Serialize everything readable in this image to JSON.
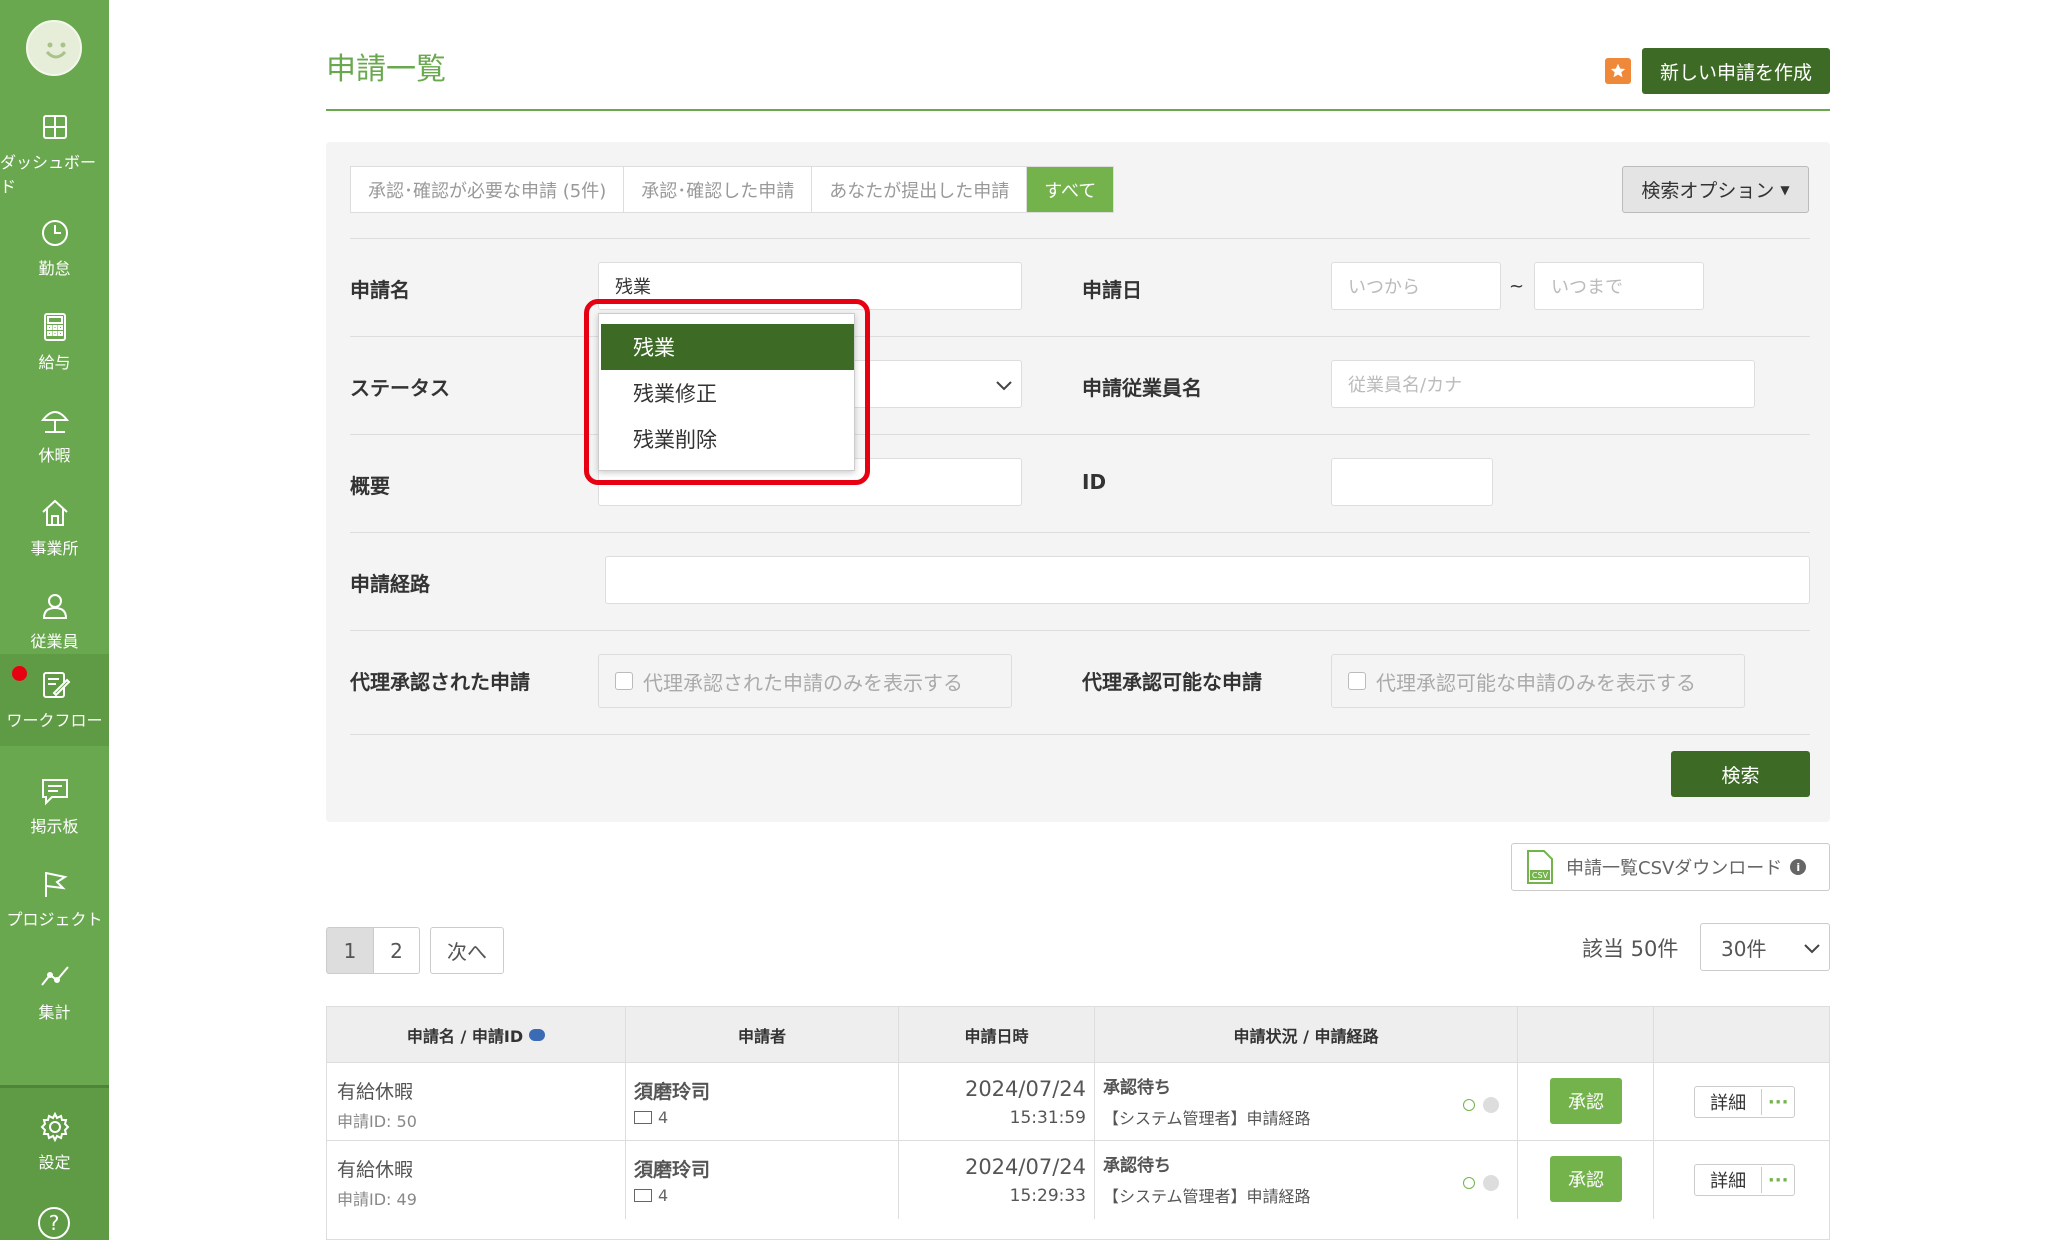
{
  "sidebar": {
    "items": [
      {
        "label": "ダッシュボード",
        "icon": "dashboard-icon"
      },
      {
        "label": "勤怠",
        "icon": "clock-icon"
      },
      {
        "label": "給与",
        "icon": "calculator-icon"
      },
      {
        "label": "休暇",
        "icon": "beach-umbrella-icon"
      },
      {
        "label": "事業所",
        "icon": "home-icon"
      },
      {
        "label": "従業員",
        "icon": "user-icon"
      },
      {
        "label": "ワークフロー",
        "icon": "workflow-icon"
      },
      {
        "label": "掲示板",
        "icon": "chat-icon"
      },
      {
        "label": "プロジェクト",
        "icon": "flag-icon"
      },
      {
        "label": "集計",
        "icon": "chart-line-icon"
      }
    ],
    "settings_label": "設定",
    "help_label": "?"
  },
  "header": {
    "title": "申請一覧",
    "new_button": "新しい申請を作成"
  },
  "tabs": [
    "承認･確認が必要な申請 (5件)",
    "承認･確認した申請",
    "あなたが提出した申請",
    "すべて"
  ],
  "search_option_label": "検索オプション",
  "form": {
    "name_label": "申請名",
    "name_value": "残業",
    "date_label": "申請日",
    "date_from_placeholder": "いつから",
    "date_tilde": "~",
    "date_to_placeholder": "いつまで",
    "status_label": "ステータス",
    "employee_label": "申請従業員名",
    "employee_placeholder": "従業員名/カナ",
    "summary_label": "概要",
    "id_label": "ID",
    "route_label": "申請経路",
    "proxy_approved_label": "代理承認された申請",
    "proxy_approved_check": "代理承認された申請のみを表示する",
    "proxy_possible_label": "代理承認可能な申請",
    "proxy_possible_check": "代理承認可能な申請のみを表示する",
    "search_button": "検索"
  },
  "dropdown": {
    "options": [
      "残業",
      "残業修正",
      "残業削除"
    ],
    "selected_index": 0
  },
  "csv_button": "申請一覧CSVダウンロード",
  "pager": {
    "pages": [
      "1",
      "2"
    ],
    "next": "次へ",
    "current": "1"
  },
  "result_count": "該当 50件",
  "per_page": "30件",
  "table": {
    "headers": [
      "申請名 / 申請ID",
      "申請者",
      "申請日時",
      "申請状況 / 申請経路",
      "",
      ""
    ],
    "rows": [
      {
        "name": "有給休暇",
        "id": "申請ID: 50",
        "applicant": "須磨玲司",
        "badge": "4",
        "date": "2024/07/24",
        "time": "15:31:59",
        "status": "承認待ち",
        "route": "【システム管理者】申請経路",
        "approve": "承認",
        "detail": "詳細"
      },
      {
        "name": "有給休暇",
        "id": "申請ID: 49",
        "applicant": "須磨玲司",
        "badge": "4",
        "date": "2024/07/24",
        "time": "15:29:33",
        "status": "承認待ち",
        "route": "【システム管理者】申請経路",
        "approve": "承認",
        "detail": "詳細"
      }
    ]
  },
  "colors": {
    "brand_green": "#6aa84f",
    "dark_green": "#3d6b26",
    "button_green": "#74b34c",
    "highlight_red": "#e60012",
    "star_orange": "#f0883a"
  }
}
